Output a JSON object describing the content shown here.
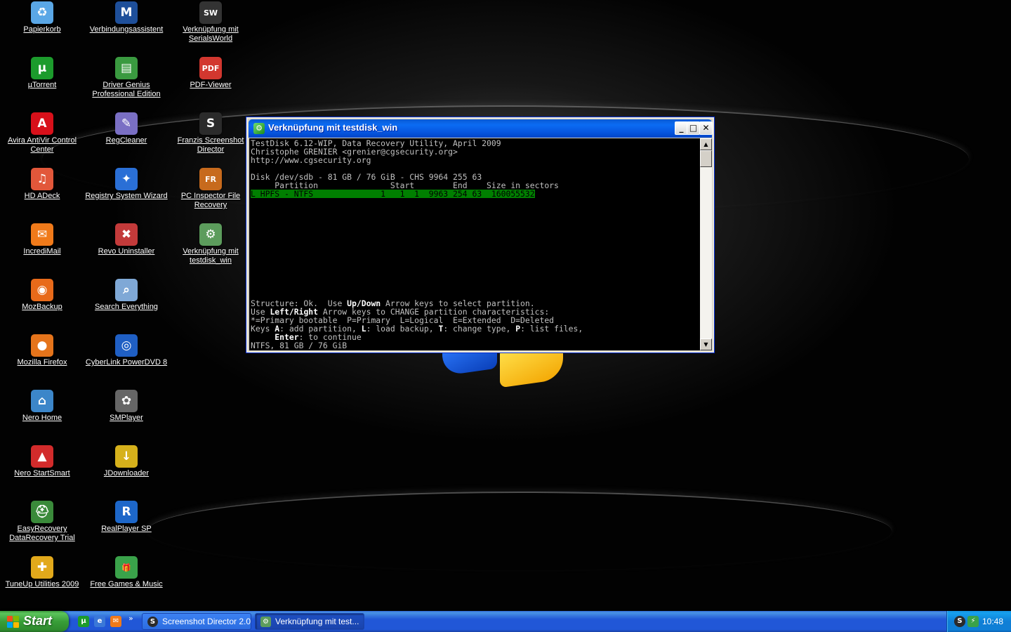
{
  "desktop": {
    "icons": [
      {
        "label": "Papierkorb",
        "icon": "recycle-bin-icon",
        "color": "#5aa7e6",
        "glyph": "♻"
      },
      {
        "label": "Verbindungsassistent",
        "icon": "connection-assistant-icon",
        "color": "#1e4f9a",
        "glyph": "M"
      },
      {
        "label": "Verknüpfung mit SerialsWorld",
        "icon": "serialsworld-icon",
        "color": "#333333",
        "glyph": "SW"
      },
      {
        "label": "µTorrent",
        "icon": "utorrent-icon",
        "color": "#1c9b2c",
        "glyph": "µ"
      },
      {
        "label": "Driver Genius Professional Edition",
        "icon": "driver-genius-icon",
        "color": "#3a9a40",
        "glyph": "▤"
      },
      {
        "label": "PDF-Viewer",
        "icon": "pdf-viewer-icon",
        "color": "#d2372f",
        "glyph": "PDF"
      },
      {
        "label": "Avira AntiVir Control Center",
        "icon": "avira-icon",
        "color": "#d8101a",
        "glyph": "A"
      },
      {
        "label": "RegCleaner",
        "icon": "regcleaner-icon",
        "color": "#7a6fc4",
        "glyph": "✎"
      },
      {
        "label": "Franzis Screenshot Director",
        "icon": "screenshot-director-icon",
        "color": "#2b2b2b",
        "glyph": "S"
      },
      {
        "label": "HD ADeck",
        "icon": "hd-adeck-icon",
        "color": "#e2573a",
        "glyph": "♫"
      },
      {
        "label": "Registry System Wizard",
        "icon": "registry-wizard-icon",
        "color": "#2a6fd6",
        "glyph": "✦"
      },
      {
        "label": "PC Inspector File Recovery",
        "icon": "pc-inspector-icon",
        "color": "#c76a1d",
        "glyph": "FR"
      },
      {
        "label": "IncrediMail",
        "icon": "incredimail-icon",
        "color": "#f07a1a",
        "glyph": "✉"
      },
      {
        "label": "Revo Uninstaller",
        "icon": "revo-uninstaller-icon",
        "color": "#c33a3a",
        "glyph": "✖"
      },
      {
        "label": "Verknüpfung mit testdisk_win",
        "icon": "testdisk-shortcut-icon",
        "color": "#5c9c5c",
        "glyph": "⚙"
      },
      {
        "label": "MozBackup",
        "icon": "mozbackup-icon",
        "color": "#e86a1a",
        "glyph": "◉"
      },
      {
        "label": "Search Everything",
        "icon": "search-everything-icon",
        "color": "#7fa8d6",
        "glyph": "⌕"
      },
      {
        "label": "Mozilla Firefox",
        "icon": "firefox-icon",
        "color": "#e5741b",
        "glyph": "●"
      },
      {
        "label": "CyberLink PowerDVD 8",
        "icon": "powerdvd-icon",
        "color": "#1f5fc4",
        "glyph": "◎"
      },
      {
        "label": "Nero Home",
        "icon": "nero-home-icon",
        "color": "#3c86c9",
        "glyph": "⌂"
      },
      {
        "label": "SMPlayer",
        "icon": "smplayer-icon",
        "color": "#666666",
        "glyph": "✿"
      },
      {
        "label": "Nero StartSmart",
        "icon": "nero-startsmart-icon",
        "color": "#d22b2b",
        "glyph": "▲"
      },
      {
        "label": "JDownloader",
        "icon": "jdownloader-icon",
        "color": "#d6b11b",
        "glyph": "↓"
      },
      {
        "label": "EasyRecovery DataRecovery Trial",
        "icon": "easyrecovery-icon",
        "color": "#3a8a3a",
        "glyph": "⛑"
      },
      {
        "label": "RealPlayer SP",
        "icon": "realplayer-icon",
        "color": "#1d67c9",
        "glyph": "R"
      },
      {
        "label": "TuneUp Utilities 2009",
        "icon": "tuneup-icon",
        "color": "#e2a91b",
        "glyph": "✚"
      },
      {
        "label": "Free Games & Music",
        "icon": "free-games-icon",
        "color": "#3aa24a",
        "glyph": "🎁"
      }
    ]
  },
  "window": {
    "title": "Verknüpfung mit testdisk_win",
    "minimize": "_",
    "maximize": "□",
    "close": "✕"
  },
  "console": {
    "header_lines": [
      "TestDisk 6.12-WIP, Data Recovery Utility, April 2009",
      "Christophe GRENIER <grenier@cgsecurity.org>",
      "http://www.cgsecurity.org"
    ],
    "disk_line": "Disk /dev/sdb - 81 GB / 76 GiB - CHS 9964 255 63",
    "column_header": "     Partition               Start        End    Size in sectors",
    "selected_row": "L HPFS - NTFS              1   1  1  9963 254 63  160055532",
    "help": {
      "line1_a": "Structure: Ok.  Use ",
      "line1_b": "Up/Down",
      "line1_c": " Arrow keys to select partition.",
      "line2_a": "Use ",
      "line2_b": "Left/Right",
      "line2_c": " Arrow keys to CHANGE partition characteristics:",
      "line3": "*=Primary bootable  P=Primary  L=Logical  E=Extended  D=Deleted",
      "line4_a": "Keys ",
      "line4_b": "A",
      "line4_c": ": add partition, ",
      "line4_d": "L",
      "line4_e": ": load backup, ",
      "line4_f": "T",
      "line4_g": ": change type, ",
      "line4_h": "P",
      "line4_i": ": list files,",
      "line5_a": "     ",
      "line5_b": "Enter",
      "line5_c": ": to continue",
      "line6": "NTFS, 81 GB / 76 GiB"
    }
  },
  "taskbar": {
    "start_label": "Start",
    "quicklaunch_more": "»",
    "tasks": [
      {
        "label": "Screenshot Director 2.0",
        "icon": "screenshot-director-icon"
      },
      {
        "label": "Verknüpfung mit test...",
        "icon": "testdisk-icon"
      }
    ],
    "clock": "10:48"
  },
  "colors": {
    "xp_blue": "#2157d7",
    "start_green": "#389e38",
    "console_selected": "#007f00"
  }
}
